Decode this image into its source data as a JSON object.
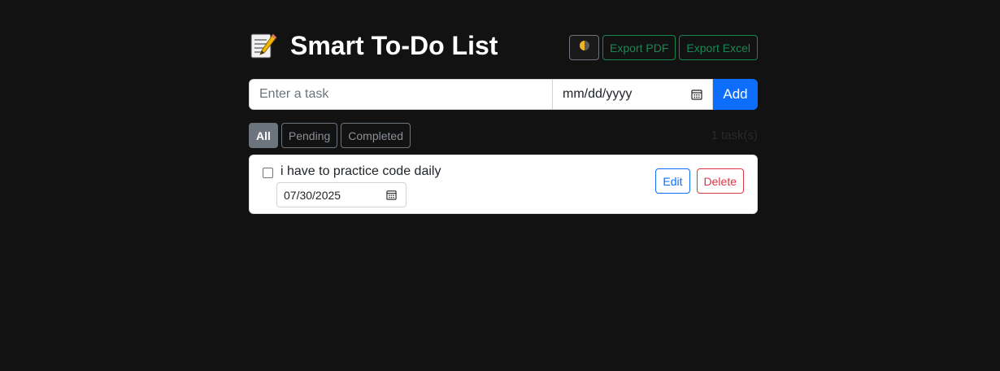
{
  "header": {
    "title": "Smart To-Do List",
    "title_icon": "memo-pencil-icon",
    "theme_toggle_icon": "half-moon-icon",
    "export_pdf_label": "Export PDF",
    "export_excel_label": "Export Excel"
  },
  "new_task": {
    "task_placeholder": "Enter a task",
    "task_value": "",
    "date_placeholder": "mm/dd/yyyy",
    "add_label": "Add"
  },
  "filters": {
    "items": [
      {
        "label": "All",
        "active": true
      },
      {
        "label": "Pending",
        "active": false
      },
      {
        "label": "Completed",
        "active": false
      }
    ],
    "count_text": "1 task(s)"
  },
  "tasks": [
    {
      "text": "i have to practice code daily",
      "completed": false,
      "due_date": "07/30/2025",
      "edit_label": "Edit",
      "delete_label": "Delete"
    }
  ],
  "colors": {
    "background": "#121212",
    "primary": "#0d6efd",
    "success": "#198754",
    "danger": "#dc3545",
    "secondary": "#6c757d"
  }
}
